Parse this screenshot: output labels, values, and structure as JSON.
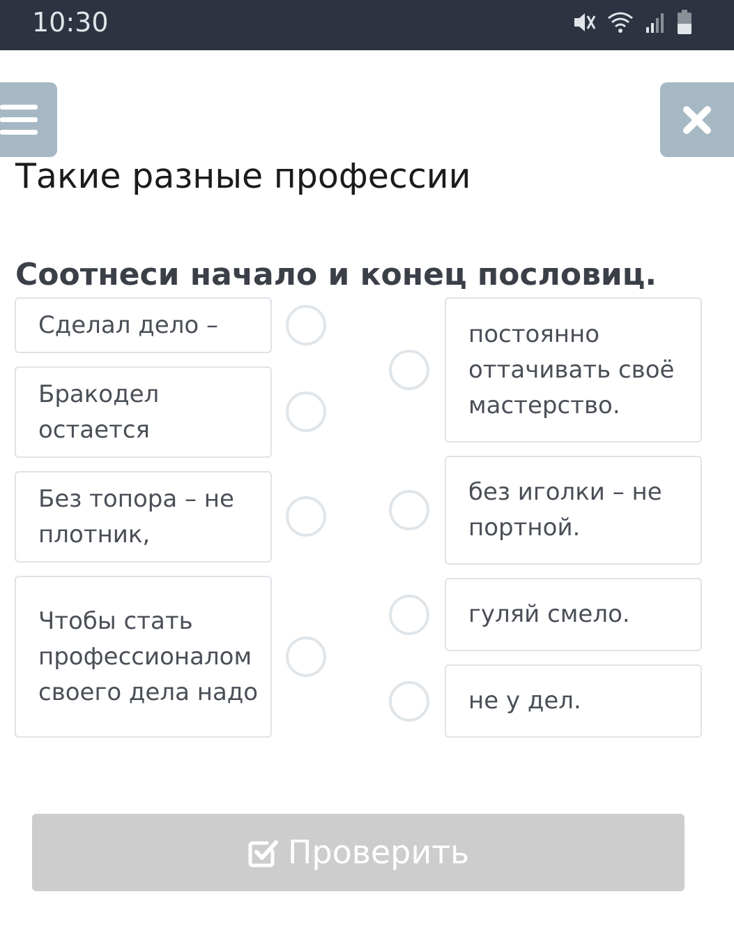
{
  "status_bar": {
    "time": "10:30",
    "icons": [
      "mute-icon",
      "wifi-icon",
      "signal-icon",
      "battery-icon"
    ]
  },
  "header": {
    "menu_icon": "hamburger-icon",
    "close_icon": "close-icon",
    "title": "Такие разные профессии"
  },
  "task": {
    "question": "Соотнеси начало и конец пословиц.",
    "left_items": [
      {
        "label": "Сделал дело –"
      },
      {
        "label": "Бракодел остается"
      },
      {
        "label": "Без топора – не плотник,"
      },
      {
        "label": "Чтобы стать профессионалом своего дела надо"
      }
    ],
    "right_items": [
      {
        "label": "постоянно оттачивать своё мастерство."
      },
      {
        "label": "без иголки – не портной."
      },
      {
        "label": "гуляй смело."
      },
      {
        "label": "не у дел."
      }
    ]
  },
  "footer": {
    "check_label": "Проверить",
    "check_icon": "check-square-icon"
  },
  "colors": {
    "status_bar_bg": "#2d3340",
    "header_button_bg": "#a5b8c4",
    "check_button_bg": "#cdcdcd",
    "card_border": "#dfe3e8"
  }
}
